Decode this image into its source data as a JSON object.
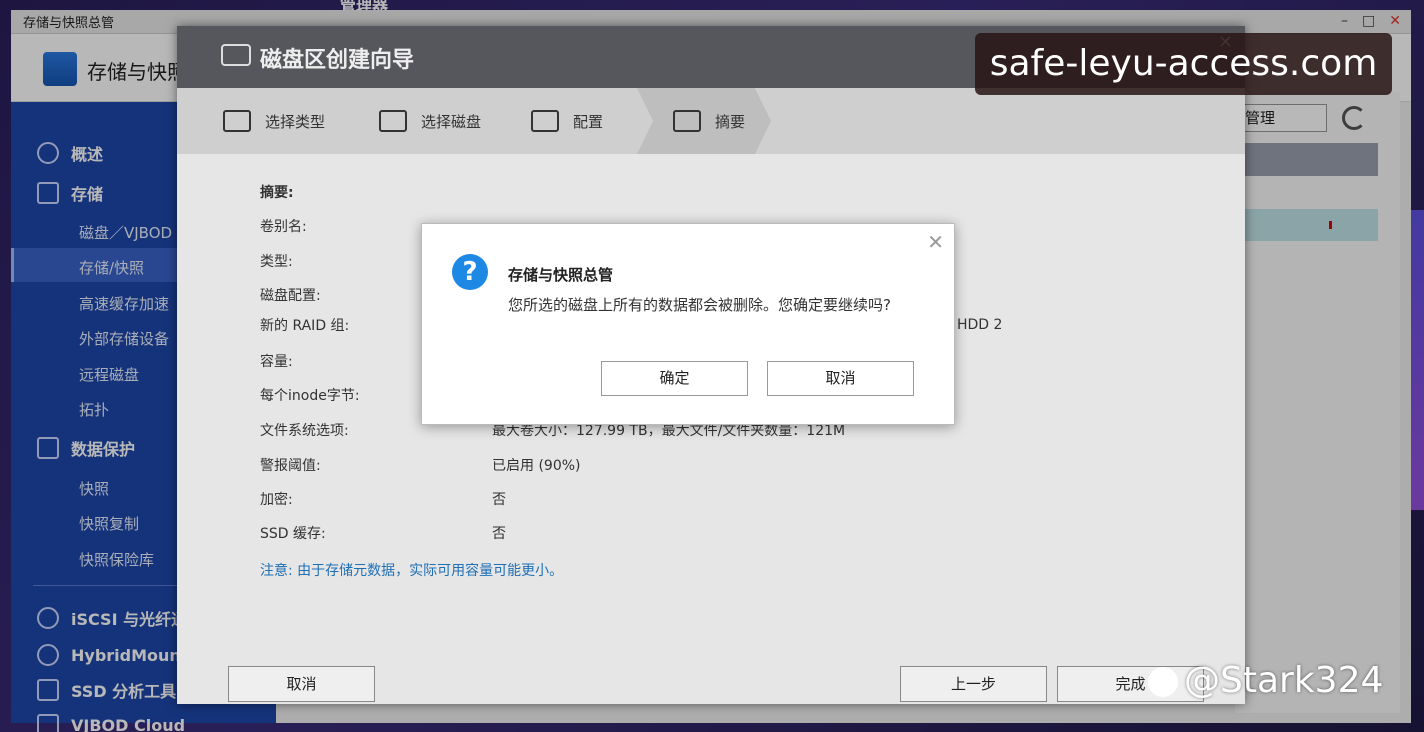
{
  "desktop": {
    "top_label": "管理器"
  },
  "app": {
    "title": "存储与快照总管",
    "header_name": "存储与快照总管",
    "win_controls": {
      "minimize": "–",
      "maximize": "□",
      "close": "✕"
    },
    "manage_label": "管理"
  },
  "sidebar": {
    "overview": "概述",
    "storage": "存储",
    "storage_sub": [
      "磁盘／VJBOD",
      "存储/快照",
      "高速缓存加速",
      "外部存储设备",
      "远程磁盘",
      "拓扑"
    ],
    "protection": "数据保护",
    "protection_sub": [
      "快照",
      "快照复制",
      "快照保险库"
    ],
    "iscsi": "iSCSI 与光纤通",
    "hybridmount": "HybridMount",
    "ssd": "SSD 分析工具",
    "vjbod_cloud": "VJBOD Cloud"
  },
  "wizard": {
    "title": "磁盘区创建向导",
    "close": "✕",
    "steps": [
      "选择类型",
      "选择磁盘",
      "配置",
      "摘要"
    ],
    "summary_heading": "摘要:",
    "rows": [
      {
        "k": "卷别名:",
        "v": ""
      },
      {
        "k": "类型:",
        "v": ""
      },
      {
        "k": "磁盘配置:",
        "v": ""
      },
      {
        "k": "新的 RAID 组:",
        "v": ""
      },
      {
        "k": "容量:",
        "v": ""
      },
      {
        "k": "每个inode字节:",
        "v": ""
      },
      {
        "k": "文件系统选项:",
        "v": "最大卷大小：127.99 TB，最大文件/文件夹数量：121M"
      },
      {
        "k": "警报阈值:",
        "v": "已启用 (90%)"
      },
      {
        "k": "加密:",
        "v": "否"
      },
      {
        "k": "SSD 缓存:",
        "v": "否"
      }
    ],
    "raid_tail": "HDD 2",
    "note": "注意: 由于存储元数据，实际可用容量可能更小。",
    "cancel": "取消",
    "prev": "上一步",
    "finish": "完成"
  },
  "dialog": {
    "title": "存储与快照总管",
    "message": "您所选的磁盘上所有的数据都会被删除。您确定要继续吗?",
    "ok": "确定",
    "cancel": "取消",
    "close": "✕"
  },
  "watermarks": {
    "url": "safe-leyu-access.com",
    "handle": "@Stark324"
  }
}
